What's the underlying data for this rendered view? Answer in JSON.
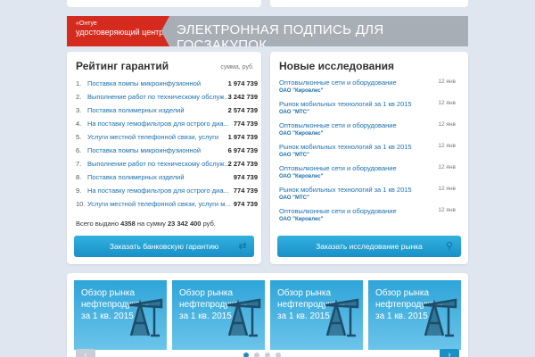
{
  "banner": {
    "logo_line1": "«Онтуе",
    "logo_line2": "удостоверяющий центр",
    "title": "ЭЛЕКТРОННАЯ ПОДПИСЬ ДЛЯ ГОСЗАКУПОК"
  },
  "ratings": {
    "title": "Рейтинг гарантий",
    "sum_header": "сумма, руб.",
    "rows": [
      {
        "num": "1.",
        "name": "Поставка помпы микроинфузионной",
        "sum": "1 974 739"
      },
      {
        "num": "2.",
        "name": "Выполнение работ по техническому обслуж...",
        "sum": "3 242 739"
      },
      {
        "num": "3.",
        "name": "Поставка полимерных изделий",
        "sum": "2 574 739"
      },
      {
        "num": "4.",
        "name": "На поставку гемофильтров для острого диа...",
        "sum": "774 739"
      },
      {
        "num": "5.",
        "name": "Услуги местной телефонной связи, услуги",
        "sum": "1 974 739"
      },
      {
        "num": "6.",
        "name": "Поставка помпы микроинфузионной",
        "sum": "6 974 739"
      },
      {
        "num": "7.",
        "name": "Выполнение работ по техническому обслуж...",
        "sum": "2 274 739"
      },
      {
        "num": "8.",
        "name": "Поставка полимерных изделий",
        "sum": "974 739"
      },
      {
        "num": "9.",
        "name": "На поставку гемофильтров для острого диа...",
        "sum": "774 739"
      },
      {
        "num": "10.",
        "name": "Услуги местной телефонной связи, услуги м...",
        "sum": "974 739"
      }
    ],
    "total_prefix": "Всего выдано",
    "total_count": "4358",
    "total_mid": "на сумму",
    "total_sum": "23 342 400",
    "total_suffix": "руб.",
    "button_label": "Заказать банковскую гарантию"
  },
  "studies": {
    "title": "Новые исследования",
    "items": [
      {
        "title": "Оптовылконные сети и оборудование",
        "company": "ОАО \"Кировлес\"",
        "date": "12 янв"
      },
      {
        "title": "Рынок мобильных технологий за 1 кв 2015",
        "company": "ОАО \"МТС\"",
        "date": "12 янв"
      },
      {
        "title": "Оптовылконные сети и оборудование",
        "company": "ОАО \"Кировлес\"",
        "date": "12 янв"
      },
      {
        "title": "Рынок мобильных технологий за 1 кв 2015",
        "company": "ОАО \"МТС\"",
        "date": "12 янв"
      },
      {
        "title": "Оптовылконные сети и оборудование",
        "company": "ОАО \"Кировлес\"",
        "date": "12 янв"
      },
      {
        "title": "Рынок мобильных технологий за 1 кв 2015",
        "company": "ОАО \"МТС\"",
        "date": "12 янв"
      },
      {
        "title": "Оптовылконные сети и оборудование",
        "company": "ОАО \"Кировлес\"",
        "date": "12 янв"
      }
    ],
    "button_label": "Заказать исследование рынка"
  },
  "carousel": {
    "tiles": [
      {
        "line1": "Обзор рынка",
        "line2": "нефтепродуктов",
        "line3": "за 1 кв. 2015"
      },
      {
        "line1": "Обзор рынка",
        "line2": "нефтепродуктов",
        "line3": "за 1 кв. 2015"
      },
      {
        "line1": "Обзор рынка",
        "line2": "нефтепродуктов",
        "line3": "за 1 кв. 2015"
      },
      {
        "line1": "Обзор рынка",
        "line2": "нефтепродуктов",
        "line3": "за 1 кв. 2015"
      }
    ],
    "prev_icon": "‹",
    "next_icon": "›",
    "active_dot": 1
  }
}
